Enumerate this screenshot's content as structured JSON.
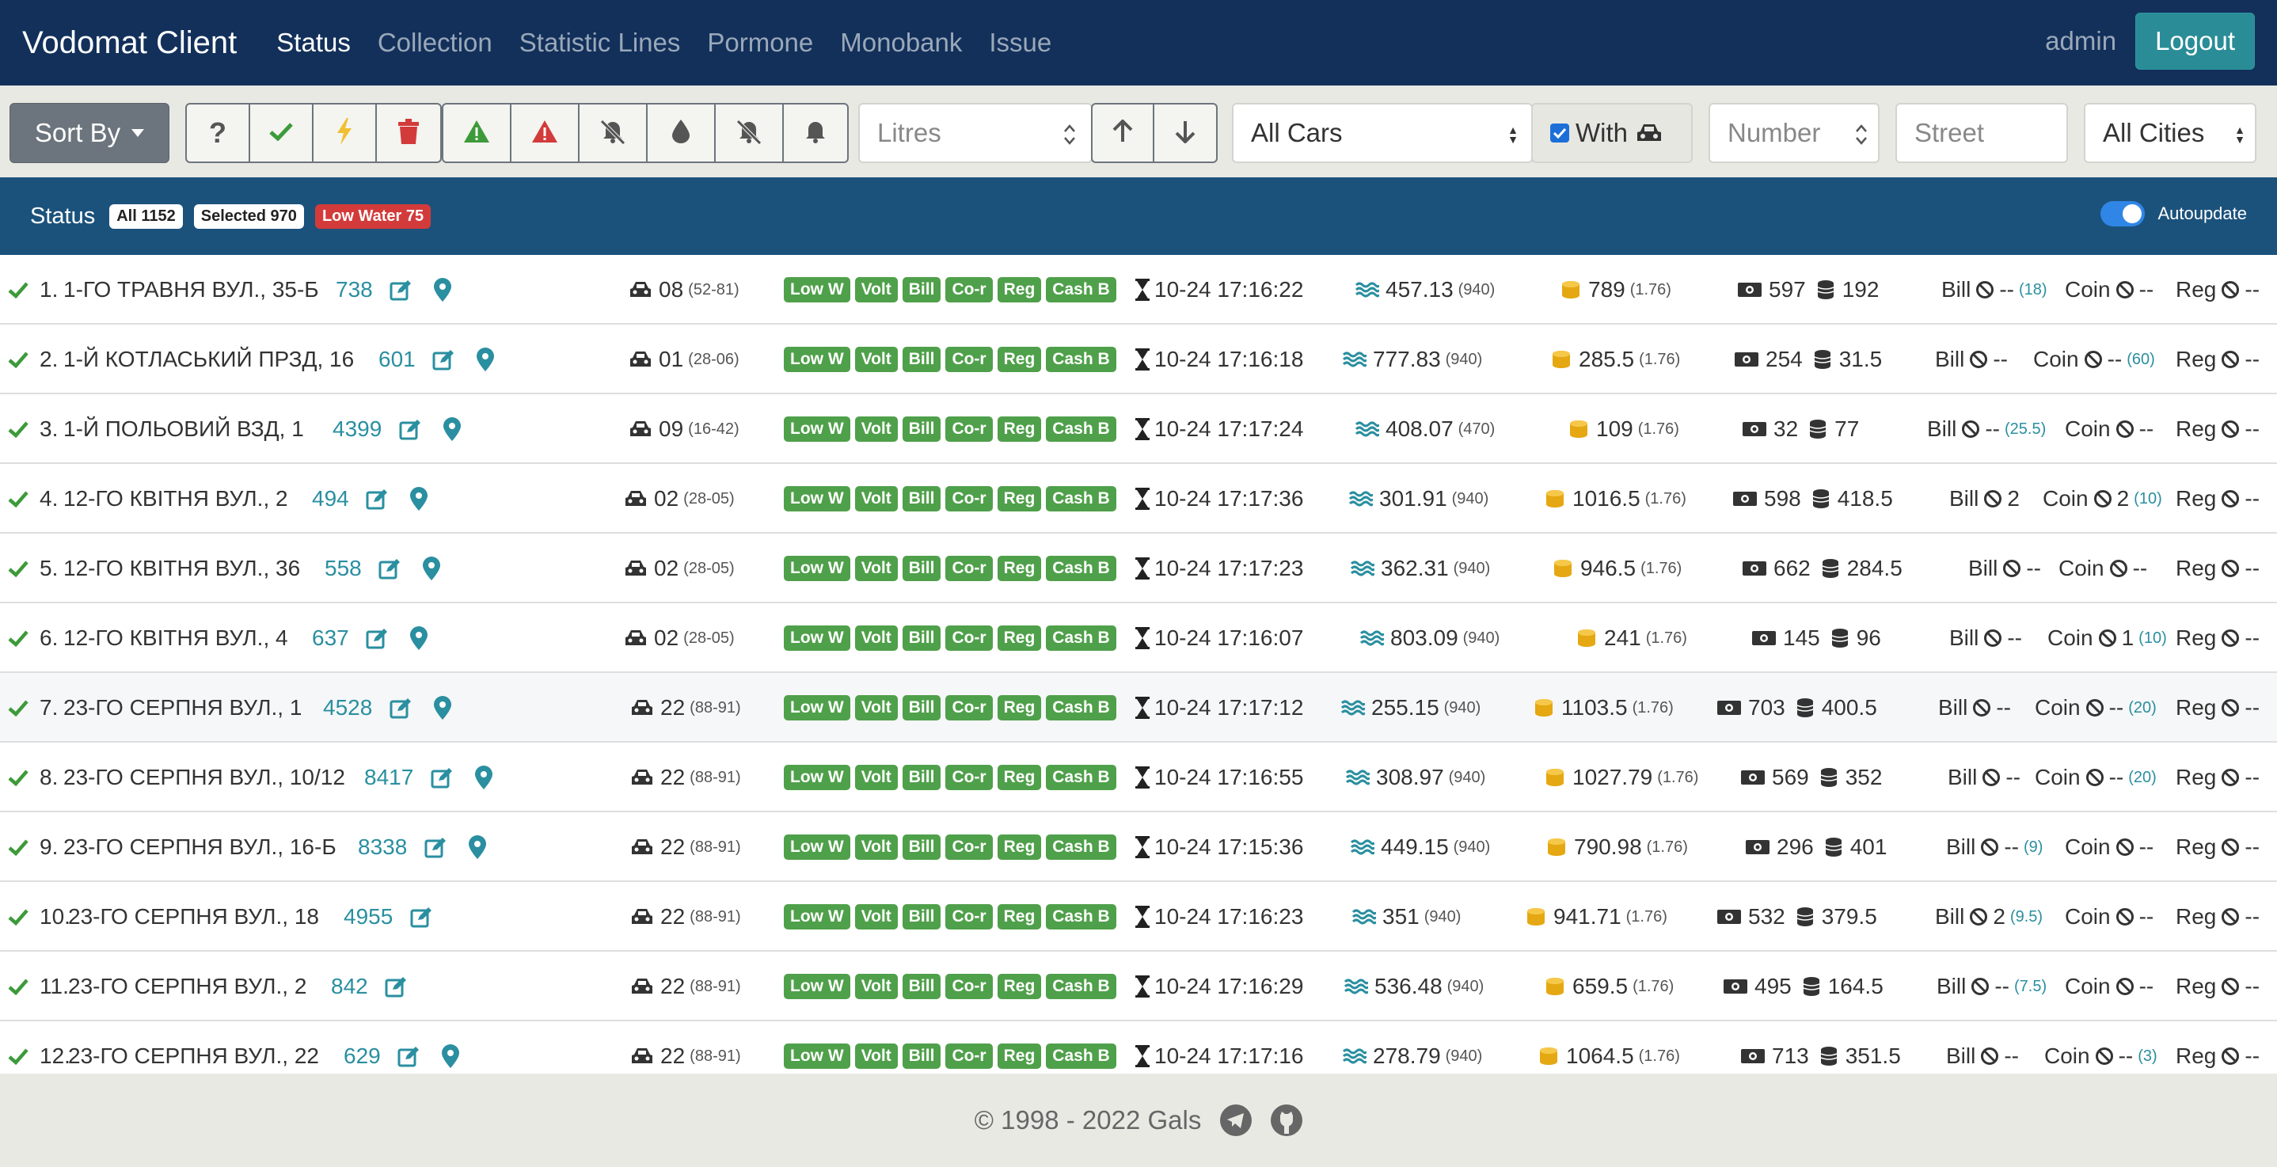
{
  "navbar": {
    "brand": "Vodomat Client",
    "links": [
      "Status",
      "Collection",
      "Statistic Lines",
      "Pormone",
      "Monobank",
      "Issue"
    ],
    "active": "Status",
    "user": "admin",
    "logout_label": "Logout"
  },
  "toolbar": {
    "sort_label": "Sort By",
    "litres_placeholder": "Litres",
    "cars_select": "All Cars",
    "with_label": "With",
    "number_placeholder": "Number",
    "street_placeholder": "Street",
    "cities_select": "All Cities"
  },
  "status": {
    "title": "Status",
    "badge_all": "All 1152",
    "badge_selected": "Selected 970",
    "badge_low": "Low Water 75",
    "autoupdate_label": "Autoupdate"
  },
  "tags": [
    "Low W",
    "Volt",
    "Bill",
    "Co-r",
    "Reg",
    "Cash B"
  ],
  "labels": {
    "bill": "Bill",
    "coin": "Coin",
    "reg": "Reg",
    "dash": "--"
  },
  "rows": [
    {
      "num": "1.",
      "address": "1-ГО ТРАВНЯ ВУЛ., 35-Б",
      "id": "738",
      "map": true,
      "car": "08",
      "car_sub": "(52-81)",
      "time": "10-24 17:16:22",
      "water": "457.13",
      "water_sub": "(940)",
      "money": "789",
      "money_sub": "(1.76)",
      "bills": "597",
      "coins": "192",
      "bill_val": "--",
      "bill_sub": "(18)",
      "coin_val": "--",
      "coin_sub": "",
      "reg_val": "--"
    },
    {
      "num": "2.",
      "address": "1-Й КОТЛАСЬКИЙ ПРЗД, 16",
      "id": "601",
      "map": true,
      "car": "01",
      "car_sub": "(28-06)",
      "time": "10-24 17:16:18",
      "water": "777.83",
      "water_sub": "(940)",
      "money": "285.5",
      "money_sub": "(1.76)",
      "bills": "254",
      "coins": "31.5",
      "bill_val": "--",
      "bill_sub": "",
      "coin_val": "--",
      "coin_sub": "(60)",
      "reg_val": "--"
    },
    {
      "num": "3.",
      "address": "1-Й ПОЛЬОВИЙ ВЗД, 1",
      "id": "4399",
      "map": true,
      "car": "09",
      "car_sub": "(16-42)",
      "time": "10-24 17:17:24",
      "water": "408.07",
      "water_sub": "(470)",
      "money": "109",
      "money_sub": "(1.76)",
      "bills": "32",
      "coins": "77",
      "bill_val": "--",
      "bill_sub": "(25.5)",
      "coin_val": "--",
      "coin_sub": "",
      "reg_val": "--"
    },
    {
      "num": "4.",
      "address": "12-ГО КВІТНЯ ВУЛ., 2",
      "id": "494",
      "map": true,
      "car": "02",
      "car_sub": "(28-05)",
      "time": "10-24 17:17:36",
      "water": "301.91",
      "water_sub": "(940)",
      "money": "1016.5",
      "money_sub": "(1.76)",
      "bills": "598",
      "coins": "418.5",
      "bill_val": "2",
      "bill_sub": "",
      "coin_val": "2",
      "coin_sub": "(10)",
      "reg_val": "--"
    },
    {
      "num": "5.",
      "address": "12-ГО КВІТНЯ ВУЛ., 36",
      "id": "558",
      "map": true,
      "car": "02",
      "car_sub": "(28-05)",
      "time": "10-24 17:17:23",
      "water": "362.31",
      "water_sub": "(940)",
      "money": "946.5",
      "money_sub": "(1.76)",
      "bills": "662",
      "coins": "284.5",
      "bill_val": "--",
      "bill_sub": "",
      "coin_val": "--",
      "coin_sub": "",
      "reg_val": "--"
    },
    {
      "num": "6.",
      "address": "12-ГО КВІТНЯ ВУЛ., 4",
      "id": "637",
      "map": true,
      "car": "02",
      "car_sub": "(28-05)",
      "time": "10-24 17:16:07",
      "water": "803.09",
      "water_sub": "(940)",
      "money": "241",
      "money_sub": "(1.76)",
      "bills": "145",
      "coins": "96",
      "bill_val": "--",
      "bill_sub": "",
      "coin_val": "1",
      "coin_sub": "(10)",
      "reg_val": "--"
    },
    {
      "num": "7.",
      "address": "23-ГО СЕРПНЯ ВУЛ., 1",
      "id": "4528",
      "map": true,
      "car": "22",
      "car_sub": "(88-91)",
      "time": "10-24 17:17:12",
      "water": "255.15",
      "water_sub": "(940)",
      "money": "1103.5",
      "money_sub": "(1.76)",
      "bills": "703",
      "coins": "400.5",
      "bill_val": "--",
      "bill_sub": "",
      "coin_val": "--",
      "coin_sub": "(20)",
      "reg_val": "--"
    },
    {
      "num": "8.",
      "address": "23-ГО СЕРПНЯ ВУЛ., 10/12",
      "id": "8417",
      "map": true,
      "car": "22",
      "car_sub": "(88-91)",
      "time": "10-24 17:16:55",
      "water": "308.97",
      "water_sub": "(940)",
      "money": "1027.79",
      "money_sub": "(1.76)",
      "bills": "569",
      "coins": "352",
      "bill_val": "--",
      "bill_sub": "",
      "coin_val": "--",
      "coin_sub": "(20)",
      "reg_val": "--"
    },
    {
      "num": "9.",
      "address": "23-ГО СЕРПНЯ ВУЛ., 16-Б",
      "id": "8338",
      "map": true,
      "car": "22",
      "car_sub": "(88-91)",
      "time": "10-24 17:15:36",
      "water": "449.15",
      "water_sub": "(940)",
      "money": "790.98",
      "money_sub": "(1.76)",
      "bills": "296",
      "coins": "401",
      "bill_val": "--",
      "bill_sub": "(9)",
      "coin_val": "--",
      "coin_sub": "",
      "reg_val": "--"
    },
    {
      "num": "10.",
      "address": "23-ГО СЕРПНЯ ВУЛ., 18",
      "id": "4955",
      "map": false,
      "car": "22",
      "car_sub": "(88-91)",
      "time": "10-24 17:16:23",
      "water": "351",
      "water_sub": "(940)",
      "money": "941.71",
      "money_sub": "(1.76)",
      "bills": "532",
      "coins": "379.5",
      "bill_val": "2",
      "bill_sub": "(9.5)",
      "coin_val": "--",
      "coin_sub": "",
      "reg_val": "--"
    },
    {
      "num": "11.",
      "address": "23-ГО СЕРПНЯ ВУЛ., 2",
      "id": "842",
      "map": false,
      "car": "22",
      "car_sub": "(88-91)",
      "time": "10-24 17:16:29",
      "water": "536.48",
      "water_sub": "(940)",
      "money": "659.5",
      "money_sub": "(1.76)",
      "bills": "495",
      "coins": "164.5",
      "bill_val": "--",
      "bill_sub": "(7.5)",
      "coin_val": "--",
      "coin_sub": "",
      "reg_val": "--"
    },
    {
      "num": "12.",
      "address": "23-ГО СЕРПНЯ ВУЛ., 22",
      "id": "629",
      "map": true,
      "car": "22",
      "car_sub": "(88-91)",
      "time": "10-24 17:17:16",
      "water": "278.79",
      "water_sub": "(940)",
      "money": "1064.5",
      "money_sub": "(1.76)",
      "bills": "713",
      "coins": "351.5",
      "bill_val": "--",
      "bill_sub": "",
      "coin_val": "--",
      "coin_sub": "(3)",
      "reg_val": "--"
    }
  ],
  "footer": {
    "copyright": "© 1998 - 2022 Gals"
  },
  "colors": {
    "navbar": "#12305a",
    "statusbar": "#1b527c",
    "accent": "#2a8fa0",
    "tag_green": "#4fa04a",
    "danger": "#d33b3b"
  }
}
